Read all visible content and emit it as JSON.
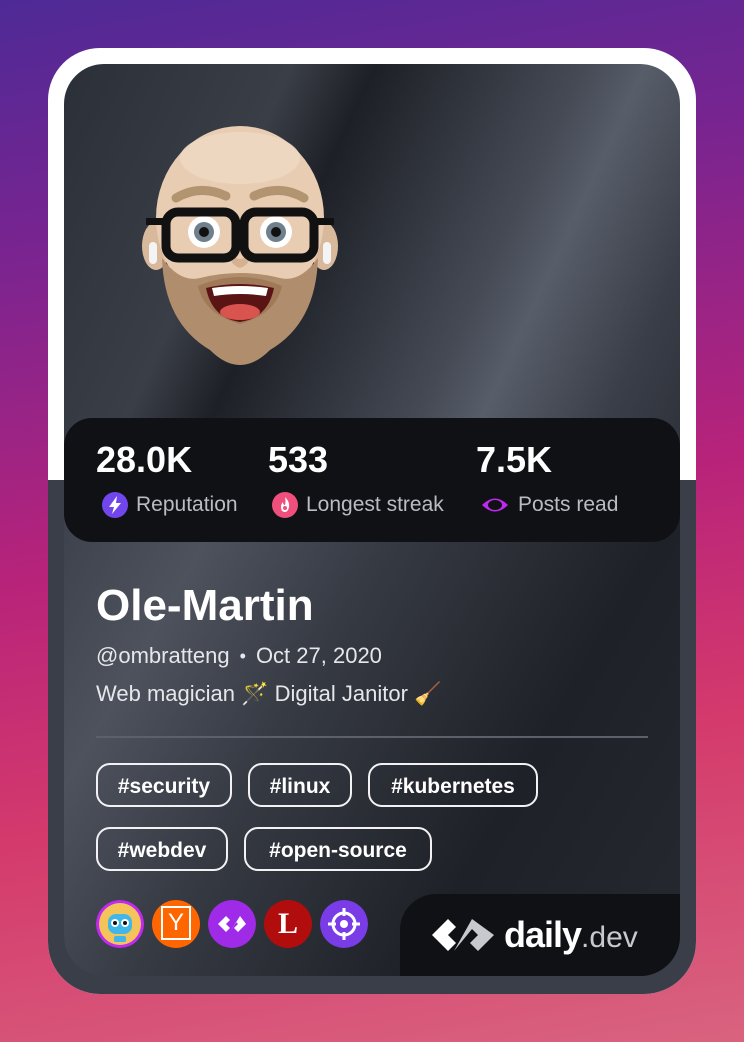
{
  "stats": [
    {
      "value": "28.0K",
      "label": "Reputation",
      "icon": "lightning-icon",
      "color": "#7147ed"
    },
    {
      "value": "533",
      "label": "Longest streak",
      "icon": "flame-icon",
      "color": "#ef4f7d"
    },
    {
      "value": "7.5K",
      "label": "Posts read",
      "icon": "eye-icon",
      "color": "#c029f0"
    }
  ],
  "profile": {
    "name": "Ole-Martin",
    "handle": "@ombratteng",
    "separator": "•",
    "joined": "Oct 27, 2020",
    "bio": "Web magician 🪄 Digital Janitor 🧹"
  },
  "tags": [
    "#security",
    "#linux",
    "#kubernetes",
    "#webdev",
    "#open-source"
  ],
  "sources": [
    {
      "name": "robot-source-icon",
      "color": "#c029f0"
    },
    {
      "name": "hacker-news-icon",
      "label": "Y",
      "color": "#ff6600"
    },
    {
      "name": "daily-dev-source-icon",
      "color": "#9f2ae8"
    },
    {
      "name": "l-source-icon",
      "label": "L",
      "color": "#b10d0d"
    },
    {
      "name": "target-source-icon",
      "color": "#7a3ce6"
    }
  ],
  "brand": {
    "name": "daily",
    "suffix": ".dev"
  },
  "colors": {
    "accent": "#7147ed",
    "card_dark": "#0f1115"
  }
}
